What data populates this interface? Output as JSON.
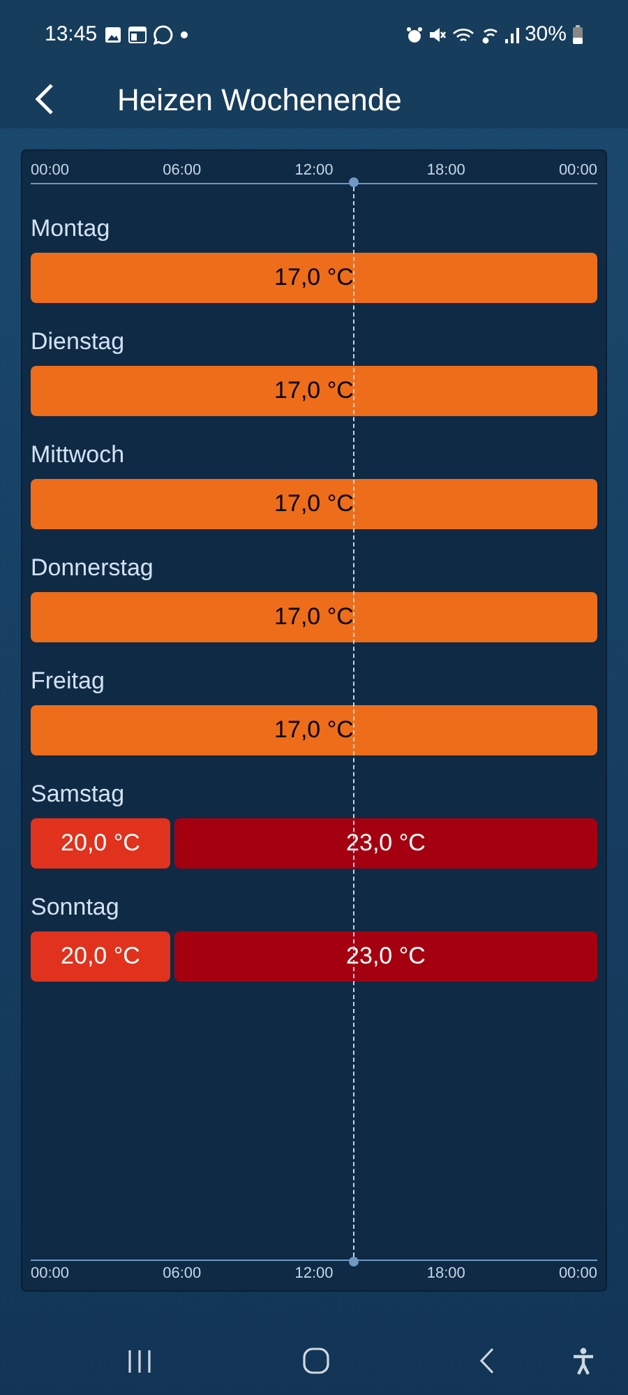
{
  "status_bar": {
    "time": "13:45",
    "battery": "30%"
  },
  "header": {
    "title": "Heizen Wochenende"
  },
  "timeline": {
    "ticks_top": [
      "00:00",
      "06:00",
      "12:00",
      "18:00",
      "00:00"
    ],
    "ticks_bottom": [
      "00:00",
      "06:00",
      "12:00",
      "18:00",
      "00:00"
    ]
  },
  "days": [
    {
      "name": "Montag",
      "segments": [
        {
          "label": "17,0 °C",
          "kind": "low",
          "color": "#ee6d1a"
        }
      ]
    },
    {
      "name": "Dienstag",
      "segments": [
        {
          "label": "17,0 °C",
          "kind": "low",
          "color": "#ee6d1a"
        }
      ]
    },
    {
      "name": "Mittwoch",
      "segments": [
        {
          "label": "17,0 °C",
          "kind": "low",
          "color": "#ee6d1a"
        }
      ]
    },
    {
      "name": "Donnerstag",
      "segments": [
        {
          "label": "17,0 °C",
          "kind": "low",
          "color": "#ee6d1a"
        }
      ]
    },
    {
      "name": "Freitag",
      "segments": [
        {
          "label": "17,0 °C",
          "kind": "low",
          "color": "#ee6d1a"
        }
      ]
    },
    {
      "name": "Samstag",
      "segments": [
        {
          "label": "20,0 °C",
          "kind": "high",
          "color": "#e0321c"
        },
        {
          "label": "23,0 °C",
          "kind": "high",
          "color": "#a50010"
        }
      ]
    },
    {
      "name": "Sonntag",
      "segments": [
        {
          "label": "20,0 °C",
          "kind": "high",
          "color": "#e0321c"
        },
        {
          "label": "23,0 °C",
          "kind": "high",
          "color": "#a50010"
        }
      ]
    }
  ]
}
